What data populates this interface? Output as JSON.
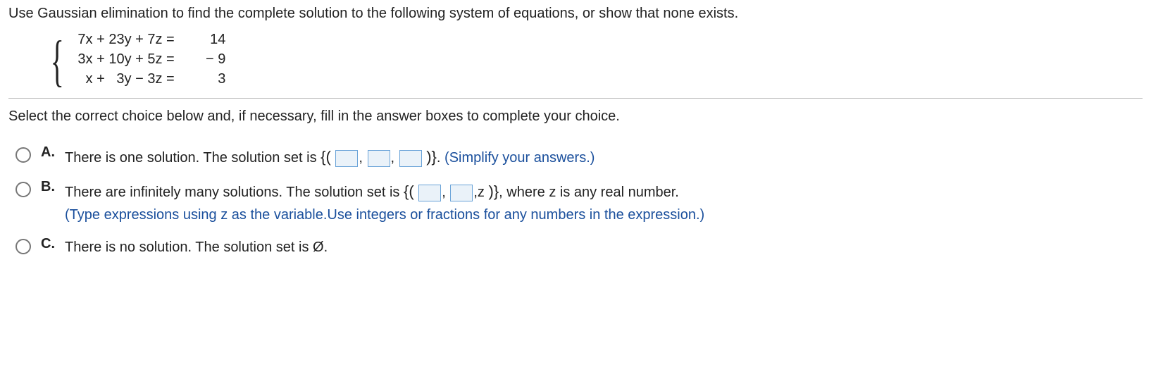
{
  "question": "Use Gaussian elimination to find the complete solution to the following system of equations, or show that none exists.",
  "equations": {
    "row1": {
      "left": "7x + 23y + 7z =",
      "right": "14"
    },
    "row2": {
      "left": "3x + 10y + 5z =",
      "right": "− 9"
    },
    "row3": {
      "left": "  x +   3y − 3z =",
      "right": "3"
    }
  },
  "instruction": "Select the correct choice below and, if necessary, fill in the answer boxes to complete your choice.",
  "choices": {
    "a": {
      "label": "A.",
      "text_before": "There is one solution. The solution set is ",
      "set_open": "{(",
      "comma": ",",
      "set_close": ")}",
      "text_after": ". ",
      "hint": "(Simplify your answers.)"
    },
    "b": {
      "label": "B.",
      "text_before": "There are infinitely many solutions. The solution set is ",
      "set_open": "{(",
      "comma": ",",
      "z_part": ",z",
      "set_close": ")}",
      "text_after": ", where z is any real number.",
      "hint": "(Type expressions using z as the variable.Use integers or fractions for any numbers in the expression.)"
    },
    "c": {
      "label": "C.",
      "text": "There is no solution. The solution set is Ø."
    }
  }
}
